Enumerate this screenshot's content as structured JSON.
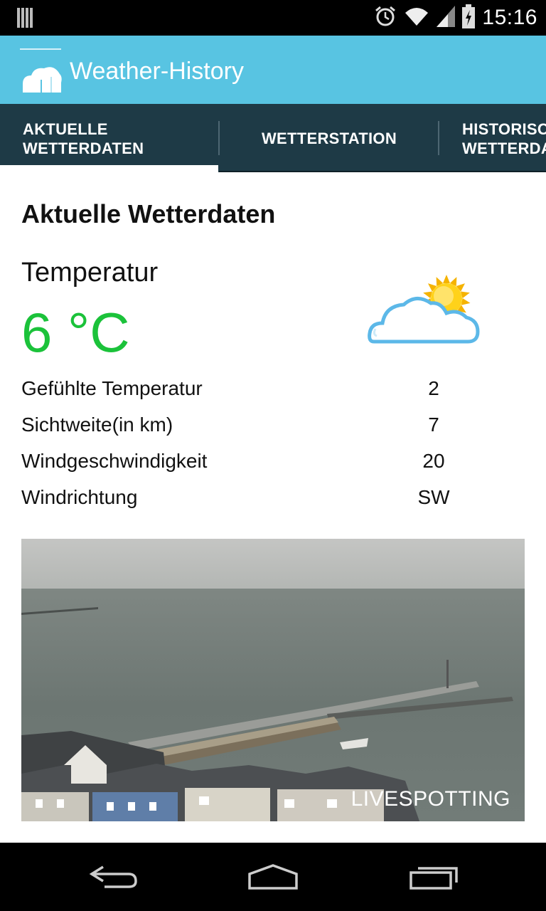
{
  "status_bar": {
    "time": "15:16",
    "icons": [
      "notification-icon",
      "alarm-icon",
      "wifi-icon",
      "signal-icon",
      "battery-icon"
    ]
  },
  "app_bar": {
    "title": "Weather-History",
    "logo": "cloud-logo-icon",
    "color": "#58c4e2"
  },
  "tabs": [
    {
      "line1": "AKTUELLE",
      "line2": "WETTERDATEN",
      "selected": true
    },
    {
      "line1": "WETTERSTATION",
      "line2": "",
      "selected": false
    },
    {
      "line1": "HISTORISC",
      "line2": "WETTERDA",
      "selected": false
    }
  ],
  "tabs_color": "#1e3a46",
  "main": {
    "heading": "Aktuelle Wetterdaten",
    "temperature": {
      "label": "Temperatur",
      "value": "6 °C",
      "color": "#1bc23a",
      "icon": "partly-cloudy-icon"
    },
    "details": [
      {
        "label": "Gefühlte Temperatur",
        "value": "2"
      },
      {
        "label": "Sichtweite(in km)",
        "value": "7"
      },
      {
        "label": "Windgeschwindigkeit",
        "value": "20"
      },
      {
        "label": "Windrichtung",
        "value": "SW"
      }
    ],
    "webcam": {
      "brand": "LIVESPOTTING"
    }
  },
  "nav_bar": {
    "icons": [
      "back-icon",
      "home-icon",
      "recent-apps-icon"
    ]
  }
}
